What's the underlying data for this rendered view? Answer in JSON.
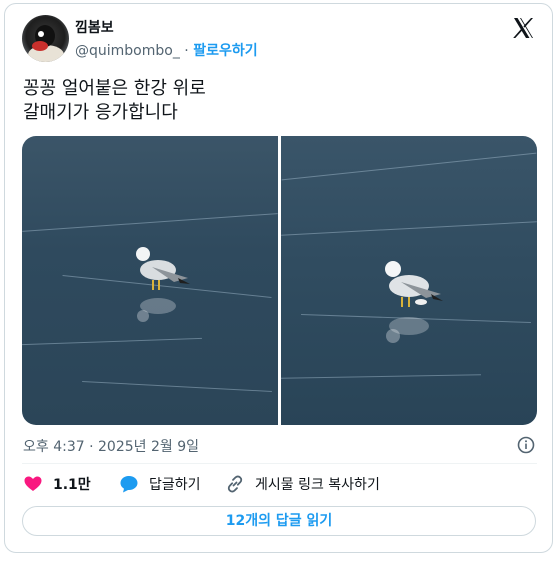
{
  "author": {
    "name": "낌봄보",
    "handle": "@quimbombo_",
    "separator": "·",
    "follow_label": "팔로우하기"
  },
  "tweet": {
    "text": "꽁꽁 얼어붙은 한강 위로\n갈매기가 응가합니다"
  },
  "timestamp": "오후 4:37 · 2025년 2월 9일",
  "actions": {
    "like_count": "1.1만",
    "reply_label": "답글하기",
    "copy_link_label": "게시물 링크 복사하기"
  },
  "read_replies_label": "12개의 답글 읽기",
  "icons": [
    "x-logo-icon",
    "info-icon",
    "heart-icon",
    "reply-bubble-icon",
    "link-icon"
  ],
  "colors": {
    "accent": "#1d9bf0",
    "like": "#f91880",
    "text_secondary": "#536471",
    "border": "#cfd9de"
  }
}
